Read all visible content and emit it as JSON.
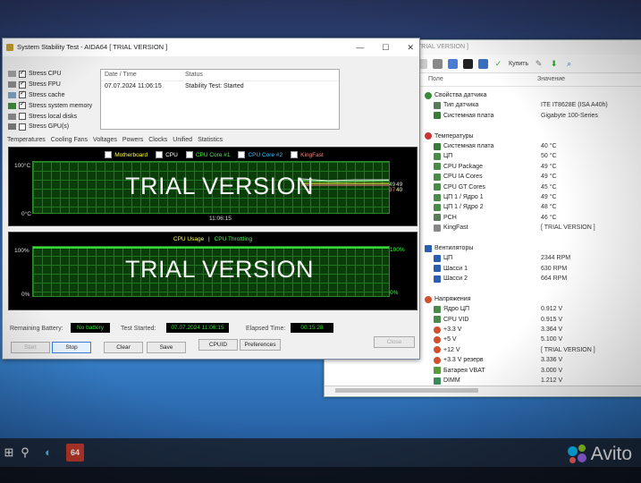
{
  "sensor_window": {
    "title": "TRIAL VERSION ]",
    "toolbar": {
      "update_label": "Купить"
    },
    "col_field": "Поле",
    "col_value": "Значение",
    "rows": [
      {
        "label": "Свойства датчика",
        "value": "",
        "group": true,
        "icon": "sensor-icon"
      },
      {
        "label": "Тип датчика",
        "value": "ITE IT8628E  (ISA A40h)",
        "icon": "chip-icon"
      },
      {
        "label": "Системная плата",
        "value": "Gigabyte 100-Series",
        "icon": "board-icon"
      },
      {
        "label": "",
        "value": ""
      },
      {
        "label": "Температуры",
        "value": "",
        "group": true,
        "icon": "thermometer-icon"
      },
      {
        "label": "Системная плата",
        "value": "40 °C",
        "icon": "board-icon"
      },
      {
        "label": "ЦП",
        "value": "50 °C",
        "icon": "cpu-icon"
      },
      {
        "label": "CPU Package",
        "value": "49 °C",
        "icon": "cpu-icon"
      },
      {
        "label": "CPU IA Cores",
        "value": "49 °C",
        "icon": "cpu-icon"
      },
      {
        "label": "CPU GT Cores",
        "value": "45 °C",
        "icon": "cpu-icon"
      },
      {
        "label": "ЦП 1 / Ядро 1",
        "value": "49 °C",
        "icon": "cpu-icon"
      },
      {
        "label": "ЦП 1 / Ядро 2",
        "value": "48 °C",
        "icon": "cpu-icon"
      },
      {
        "label": "PCH",
        "value": "46 °C",
        "icon": "chip-icon"
      },
      {
        "label": "KingFast",
        "value": "[ TRIAL VERSION ]",
        "icon": "disk-icon"
      },
      {
        "label": "",
        "value": ""
      },
      {
        "label": "Вентиляторы",
        "value": "",
        "group": true,
        "icon": "fan-icon"
      },
      {
        "label": "ЦП",
        "value": "2344 RPM",
        "icon": "fan-icon"
      },
      {
        "label": "Шасси 1",
        "value": "630 RPM",
        "icon": "fan-icon"
      },
      {
        "label": "Шасси 2",
        "value": "664 RPM",
        "icon": "fan-icon"
      },
      {
        "label": "",
        "value": ""
      },
      {
        "label": "Напряжения",
        "value": "",
        "group": true,
        "icon": "voltage-icon"
      },
      {
        "label": "Ядро ЦП",
        "value": "0.912 V",
        "icon": "cpu-icon"
      },
      {
        "label": "CPU VID",
        "value": "0.915 V",
        "icon": "cpu-icon"
      },
      {
        "label": "+3.3 V",
        "value": "3.364 V",
        "icon": "voltage-icon"
      },
      {
        "label": "+5 V",
        "value": "5.100 V",
        "icon": "voltage-icon"
      },
      {
        "label": "+12 V",
        "value": "[ TRIAL VERSION ]",
        "icon": "voltage-icon"
      },
      {
        "label": "+3.3 V резерв",
        "value": "3.336 V",
        "icon": "voltage-icon"
      },
      {
        "label": "Батарея VBAT",
        "value": "3.000 V",
        "icon": "battery-icon"
      },
      {
        "label": "DIMM",
        "value": "1.212 V",
        "icon": "memory-icon"
      },
      {
        "label": "VCCSA",
        "value": "1.068 V",
        "icon": "chip-icon"
      }
    ]
  },
  "stability_window": {
    "title": "System Stability Test - AIDA64  [ TRIAL VERSION ]",
    "win_buttons": {
      "minimize": "—",
      "maximize": "☐",
      "close": "✕"
    },
    "stress_options": [
      {
        "label": "Stress CPU",
        "checked": true
      },
      {
        "label": "Stress FPU",
        "checked": true
      },
      {
        "label": "Stress cache",
        "checked": true
      },
      {
        "label": "Stress system memory",
        "checked": true
      },
      {
        "label": "Stress local disks",
        "checked": false
      },
      {
        "label": "Stress GPU(s)",
        "checked": false
      }
    ],
    "log": {
      "col_date": "Date / Time",
      "col_status": "Status",
      "entries": [
        {
          "date": "07.07.2024 11:06:15",
          "status": "Stability Test: Started"
        }
      ]
    },
    "tabs": [
      "Temperatures",
      "Cooling Fans",
      "Voltages",
      "Powers",
      "Clocks",
      "Unified",
      "Statistics"
    ],
    "graph1": {
      "legend": [
        {
          "label": "Motherboard",
          "color": "#ffff40"
        },
        {
          "label": "CPU",
          "color": "#ffffff"
        },
        {
          "label": "CPU Core #1",
          "color": "#40ff40"
        },
        {
          "label": "CPU Core #2",
          "color": "#40c0ff"
        },
        {
          "label": "KingFast",
          "color": "#ff8080"
        }
      ],
      "y_top": "100°C",
      "y_bottom": "0°C",
      "x_label": "11:06:15",
      "watermark": "TRIAL VERSION",
      "right_values": [
        "49",
        "49",
        "40",
        "37"
      ]
    },
    "graph2": {
      "legend_a": "CPU Usage",
      "legend_sep": "|",
      "legend_b": "CPU Throttling",
      "y_top": "100%",
      "y_bottom": "0%",
      "right_top": "100%",
      "right_bottom": "0%",
      "watermark": "TRIAL VERSION"
    },
    "remaining_battery_label": "Remaining Battery:",
    "remaining_battery_value": "No battery",
    "test_started_label": "Test Started:",
    "test_started_value": "07.07.2024 11:06:15",
    "elapsed_label": "Elapsed Time:",
    "elapsed_value": "00:15:28",
    "buttons": {
      "start": "Start",
      "stop": "Stop",
      "clear": "Clear",
      "save": "Save",
      "cpuid": "CPUID",
      "preferences": "Preferences",
      "close": "Close"
    }
  },
  "taskbar": {
    "badge": "64"
  },
  "watermark_brand": "Avito"
}
